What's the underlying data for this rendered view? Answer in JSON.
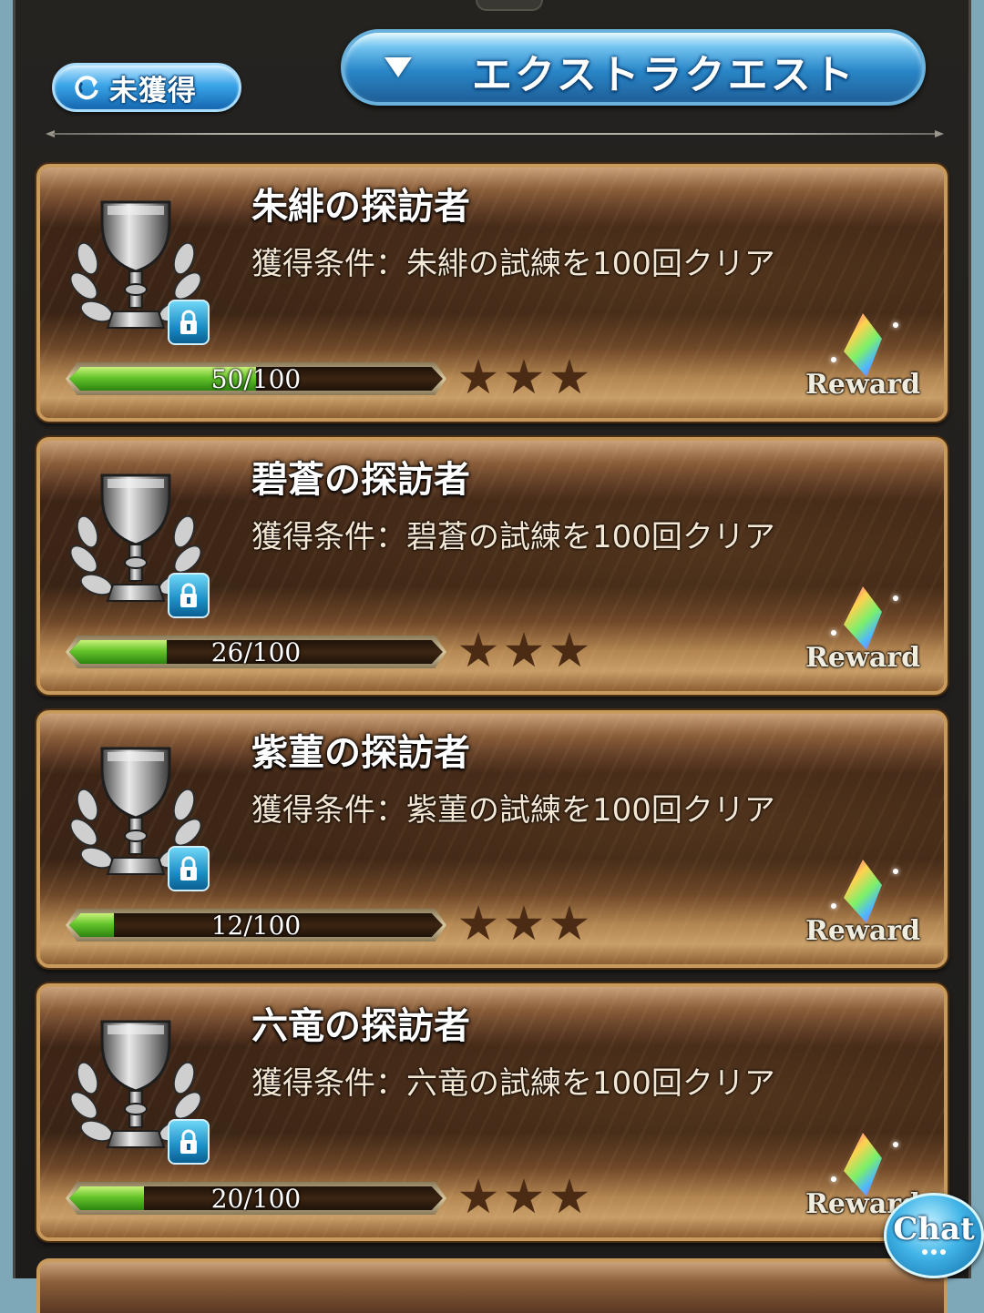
{
  "filter": {
    "label": "未獲得",
    "icon": "refresh-icon"
  },
  "category": {
    "label": "エクストラクエスト",
    "icon": "chevron-down-icon"
  },
  "trophies": [
    {
      "title": "朱緋の探訪者",
      "condition": "獲得条件：朱緋の試練を100回クリア",
      "progress_text": "50/100",
      "progress_fraction": 0.5,
      "stars": 3,
      "reward_label": "Reward"
    },
    {
      "title": "碧蒼の探訪者",
      "condition": "獲得条件：碧蒼の試練を100回クリア",
      "progress_text": "26/100",
      "progress_fraction": 0.26,
      "stars": 3,
      "reward_label": "Reward"
    },
    {
      "title": "紫菫の探訪者",
      "condition": "獲得条件：紫菫の試練を100回クリア",
      "progress_text": "12/100",
      "progress_fraction": 0.12,
      "stars": 3,
      "reward_label": "Reward"
    },
    {
      "title": "六竜の探訪者",
      "condition": "獲得条件：六竜の試練を100回クリア",
      "progress_text": "20/100",
      "progress_fraction": 0.2,
      "stars": 3,
      "reward_label": "Reward"
    }
  ],
  "chat": {
    "label": "Chat"
  },
  "colors": {
    "accent_blue": "#2986c7",
    "progress_green": "#65c52b",
    "card_brown": "#3d2516",
    "star_brown": "#4b2b14"
  }
}
